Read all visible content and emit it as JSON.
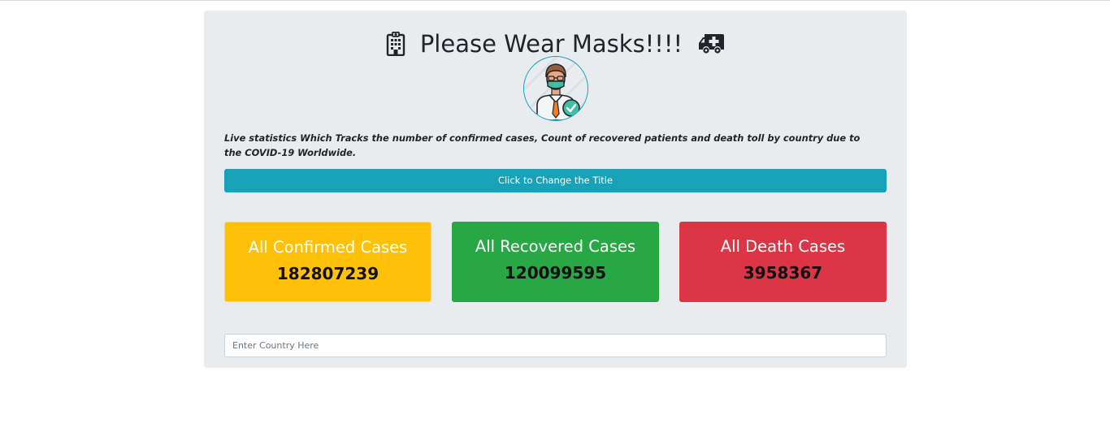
{
  "header": {
    "title": "Please Wear Masks!!!!",
    "left_icon": "hospital-icon",
    "right_icon": "ambulance-icon"
  },
  "avatar": {
    "icon": "masked-doctor-avatar"
  },
  "description": "Live statistics Which Tracks the number of confirmed cases, Count of recovered patients and death toll by country due to the COVID-19 Worldwide.",
  "change_title_button": {
    "label": "Click to Change the Title"
  },
  "cards": {
    "confirmed": {
      "title": "All Confirmed Cases",
      "value": "182807239",
      "color": "#ffc107"
    },
    "recovered": {
      "title": "All Recovered Cases",
      "value": "120099595",
      "color": "#28a745"
    },
    "death": {
      "title": "All Death Cases",
      "value": "3958367",
      "color": "#dc3545"
    }
  },
  "search": {
    "placeholder": "Enter Country Here",
    "value": ""
  },
  "colors": {
    "panel_bg": "#e9ecef",
    "button_bg": "#17a2b8"
  }
}
